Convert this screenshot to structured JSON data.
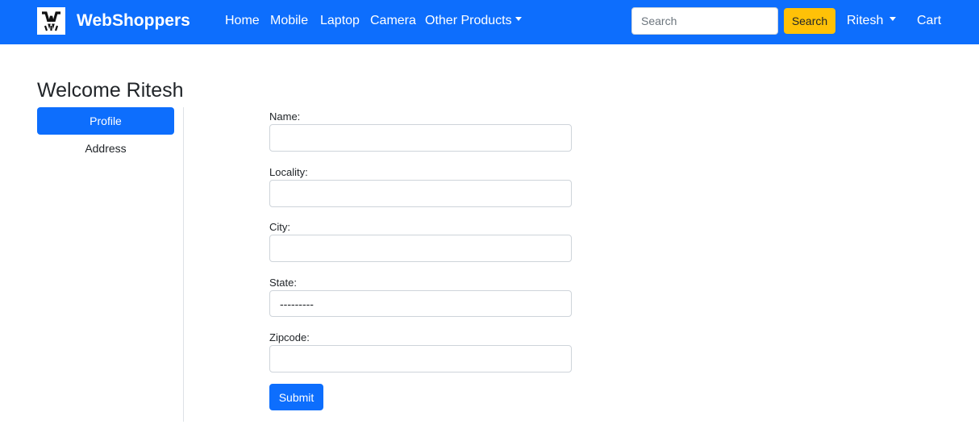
{
  "navbar": {
    "brand": "WebShoppers",
    "links": [
      "Home",
      "Mobile",
      "Laptop",
      "Camera",
      "Other Products"
    ],
    "search": {
      "placeholder": "Search",
      "button_label": "Search"
    },
    "user_menu": "Ritesh",
    "cart": "Cart",
    "bg_color": "#0d6efd",
    "search_button_color": "#ffc107"
  },
  "page": {
    "welcome": "Welcome Ritesh"
  },
  "sidebar": {
    "items": [
      {
        "label": "Profile",
        "active": true
      },
      {
        "label": "Address",
        "active": false
      }
    ]
  },
  "form": {
    "fields": [
      {
        "label": "Name:",
        "value": ""
      },
      {
        "label": "Locality:",
        "value": ""
      },
      {
        "label": "City:",
        "value": ""
      },
      {
        "label": "State:",
        "value": "---------"
      },
      {
        "label": "Zipcode:",
        "value": ""
      }
    ],
    "submit_label": "Submit"
  },
  "icons": {
    "logo": "webshoppers-logo-icon",
    "caret": "caret-down-icon"
  }
}
